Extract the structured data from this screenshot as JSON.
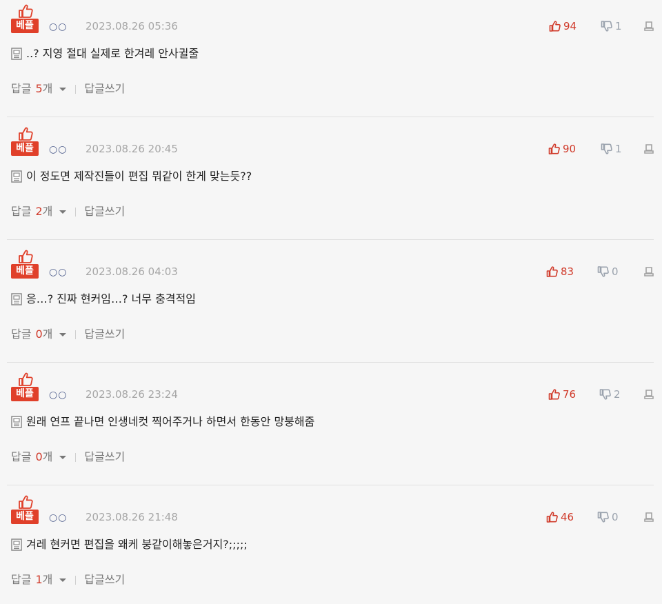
{
  "best_label": "베플",
  "reply_label": "답글",
  "reply_unit": "개",
  "write_reply_label": "답글쓰기",
  "colors": {
    "accent": "#d03a2a",
    "best_badge": "#e0402a",
    "muted": "#a6a6a6",
    "background": "#f6f6f6"
  },
  "comments": [
    {
      "nick": "○○",
      "timestamp": "2023.08.26 05:36",
      "text": "..? 지영 절대 실제로 한겨레 안사귈줄",
      "likes": "94",
      "dislikes": "1",
      "reply_count": "5"
    },
    {
      "nick": "○○",
      "timestamp": "2023.08.26 20:45",
      "text": "이 정도면 제작진들이 편집 뭐같이 한게 맞는듯??",
      "likes": "90",
      "dislikes": "1",
      "reply_count": "2"
    },
    {
      "nick": "○○",
      "timestamp": "2023.08.26 04:03",
      "text": "응…? 진짜 현커임…? 너무 충격적임",
      "likes": "83",
      "dislikes": "0",
      "reply_count": "0"
    },
    {
      "nick": "○○",
      "timestamp": "2023.08.26 23:24",
      "text": "원래 연프 끝나면 인생네컷 찍어주거나 하면서 한동안 망붕해줌",
      "likes": "76",
      "dislikes": "2",
      "reply_count": "0"
    },
    {
      "nick": "○○",
      "timestamp": "2023.08.26 21:48",
      "text": "겨레 현커면 편집을 왜케 붕같이해놓은거지?;;;;;",
      "likes": "46",
      "dislikes": "0",
      "reply_count": "1"
    }
  ]
}
